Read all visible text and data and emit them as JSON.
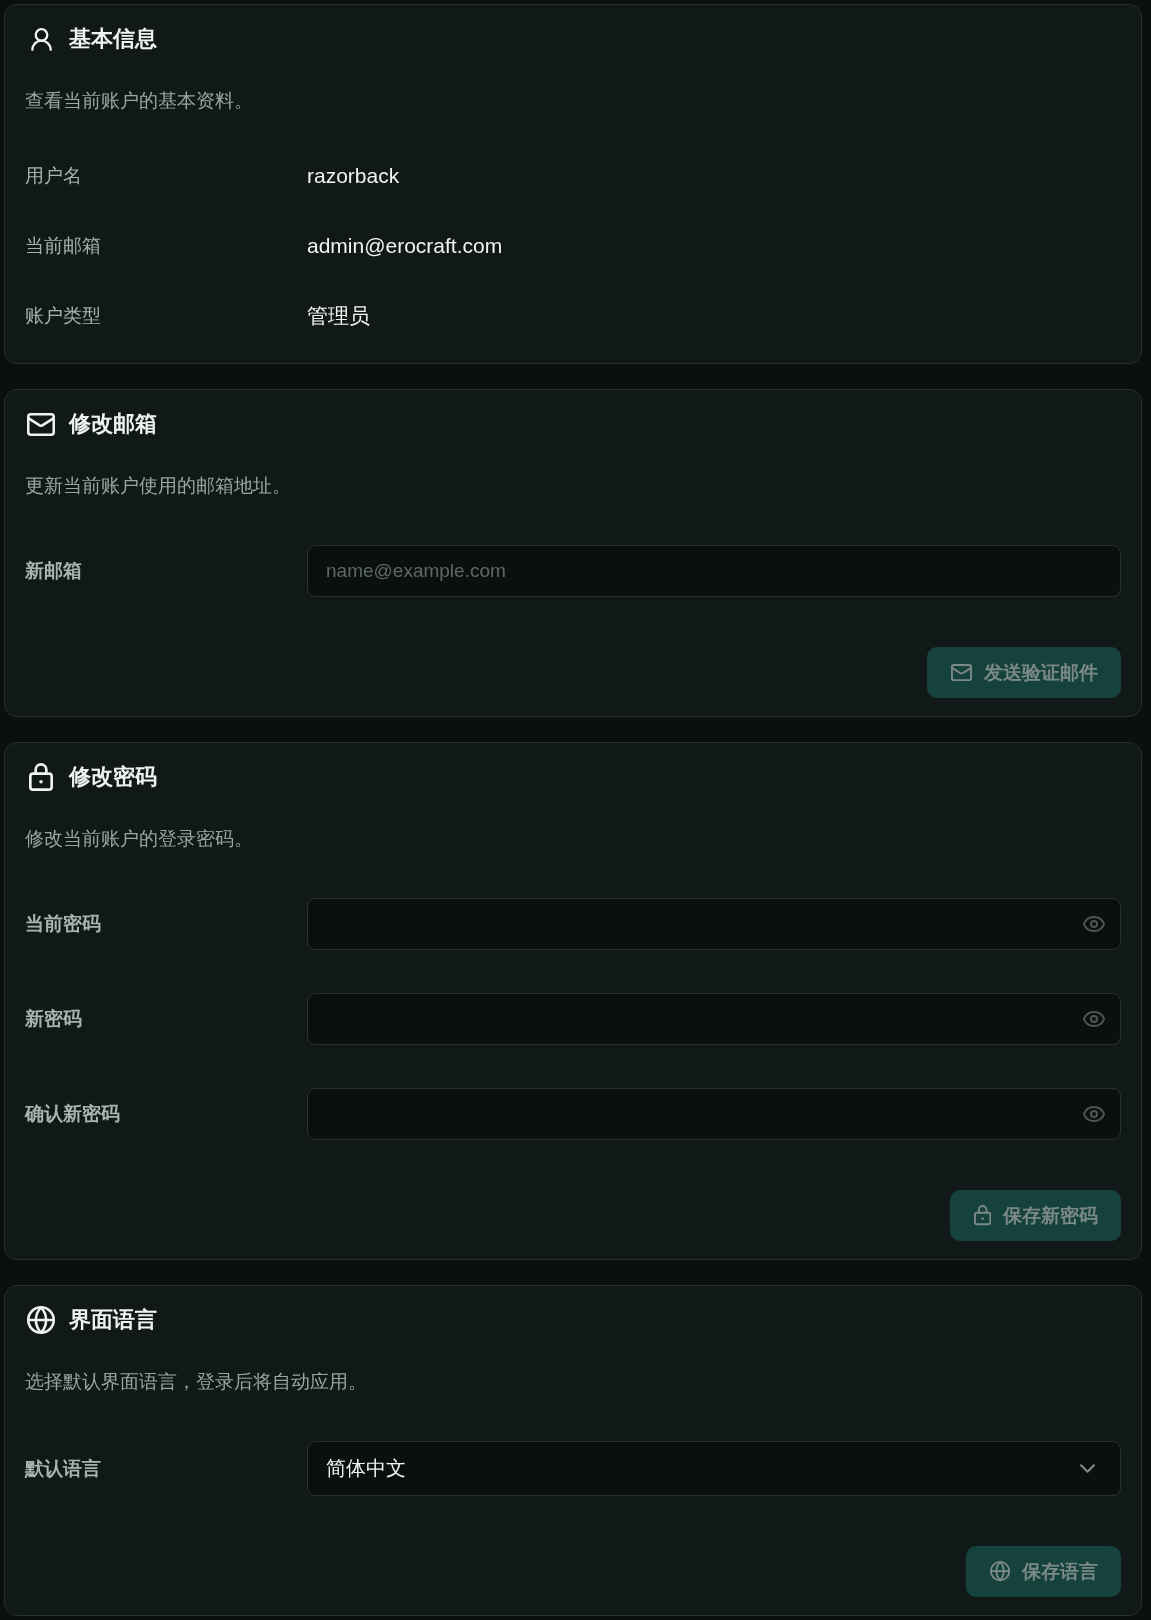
{
  "sections": [
    {
      "kind": "profile",
      "title": "基本信息",
      "description": "查看当前账户的基本资料。",
      "rows": [
        {
          "label": "用户名",
          "value": "razorback"
        },
        {
          "label": "当前邮箱",
          "value": "admin@erocraft.com"
        },
        {
          "label": "账户类型",
          "value": "管理员"
        }
      ]
    },
    {
      "kind": "email",
      "title": "修改邮箱",
      "description": "更新当前账户使用的邮箱地址。",
      "fields": [
        {
          "kind": "text",
          "label": "新邮箱",
          "placeholder": "name@example.com"
        }
      ],
      "button": {
        "label": "发送验证邮件",
        "disabled": true
      }
    },
    {
      "kind": "password",
      "title": "修改密码",
      "description": "修改当前账户的登录密码。",
      "fields": [
        {
          "kind": "password",
          "label": "当前密码"
        },
        {
          "kind": "password",
          "label": "新密码"
        },
        {
          "kind": "password",
          "label": "确认新密码"
        }
      ],
      "button": {
        "label": "保存新密码",
        "disabled": true
      }
    },
    {
      "kind": "language",
      "title": "界面语言",
      "description": "选择默认界面语言，登录后将自动应用。",
      "fields": [
        {
          "kind": "select",
          "label": "默认语言",
          "value": "简体中文"
        }
      ],
      "button": {
        "label": "保存语言",
        "disabled": true
      }
    }
  ]
}
